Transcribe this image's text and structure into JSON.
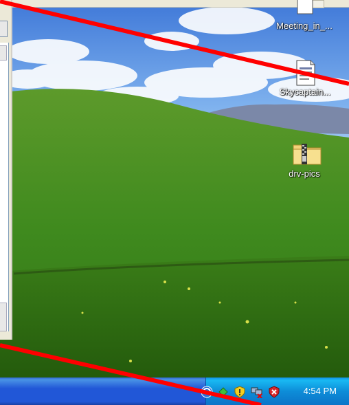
{
  "desktop": {
    "icons": [
      {
        "label": "Meeting_in_...",
        "type": "document"
      },
      {
        "label": "Skycaptain...",
        "type": "document"
      },
      {
        "label": "drv-pics",
        "type": "zip-folder"
      }
    ]
  },
  "taskbar": {
    "clock": "4:54 PM",
    "tray_icons": [
      "network-sync-icon",
      "update-shield-icon",
      "network-disconnected-icon",
      "security-alert-icon"
    ]
  },
  "colors": {
    "taskbar": "#2157d7",
    "tray": "#0d8dd8",
    "overlay_line": "#ff0000"
  }
}
